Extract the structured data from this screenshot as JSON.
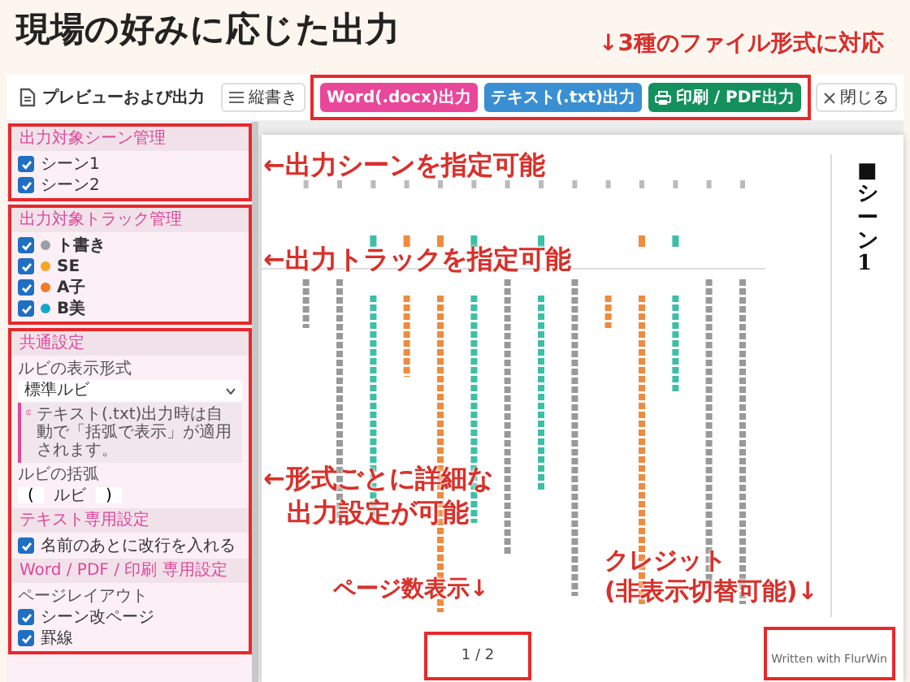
{
  "headline": "現場の好みに応じた出力",
  "top_callout": "↓3種のファイル形式に対応",
  "window": {
    "title": "プレビューおよび出力",
    "toolbar": [
      {
        "kind": "toggle",
        "label": "縦書き"
      },
      {
        "kind": "export",
        "label": "Word(.docx)出力",
        "color": "#e8479a"
      },
      {
        "kind": "export",
        "label": "テキスト(.txt)出力",
        "color": "#3a8fd2"
      },
      {
        "kind": "print",
        "label": "印刷 / PDF出力",
        "color": "#14905d"
      },
      {
        "kind": "close",
        "label": "閉じる"
      }
    ]
  },
  "sidebar": {
    "panels": [
      {
        "sections": [
          {
            "title": "出力対象シーン管理",
            "rows": [
              {
                "kind": "checkbox",
                "label": "シーン1",
                "checked": true
              },
              {
                "kind": "checkbox",
                "label": "シーン2",
                "checked": true
              }
            ]
          }
        ]
      },
      {
        "sections": [
          {
            "title": "出力対象トラック管理",
            "rows": [
              {
                "kind": "track",
                "label": "ト書き",
                "checked": true,
                "color": "#9aa0a6"
              },
              {
                "kind": "track",
                "label": "SE",
                "checked": true,
                "color": "#f5a623"
              },
              {
                "kind": "track",
                "label": "A子",
                "checked": true,
                "color": "#f07a2a"
              },
              {
                "kind": "track",
                "label": "B美",
                "checked": true,
                "color": "#17a8c8"
              }
            ]
          }
        ]
      },
      {
        "sections": [
          {
            "title": "共通設定",
            "rows": [
              {
                "kind": "label",
                "label": "ルビの表示形式"
              },
              {
                "kind": "select",
                "value": "標準ルビ"
              },
              {
                "kind": "notice",
                "label": "テキスト(.txt)出力時は自動で「括弧で表示」が適用されます。"
              },
              {
                "kind": "label",
                "label": "ルビの括弧"
              },
              {
                "kind": "brackets",
                "open": "(",
                "label": "ルビ",
                "close": ")"
              }
            ]
          },
          {
            "title": "テキスト専用設定",
            "rows": [
              {
                "kind": "checkbox",
                "label": "名前のあとに改行を入れる",
                "checked": true
              }
            ]
          },
          {
            "title": "Word / PDF / 印刷 専用設定",
            "rows": [
              {
                "kind": "label",
                "label": "ページレイアウト"
              },
              {
                "kind": "checkbox",
                "label": "シーン改ページ",
                "checked": true
              },
              {
                "kind": "checkbox",
                "label": "罫線",
                "checked": true
              }
            ]
          }
        ]
      }
    ]
  },
  "preview": {
    "scene_heading": "■シーン1",
    "page_number": "1 / 2",
    "credit": "Written with FlurWin"
  },
  "callouts": [
    {
      "lines": [
        "←出力シーンを指定可能"
      ]
    },
    {
      "lines": [
        "←出力トラックを指定可能"
      ]
    },
    {
      "lines": [
        "←形式ごとに詳細な",
        "出力設定が可能"
      ]
    },
    {
      "lines": [
        "ページ数表示↓"
      ]
    },
    {
      "lines": [
        "クレジット",
        "(非表示切替可能)↓"
      ]
    }
  ]
}
